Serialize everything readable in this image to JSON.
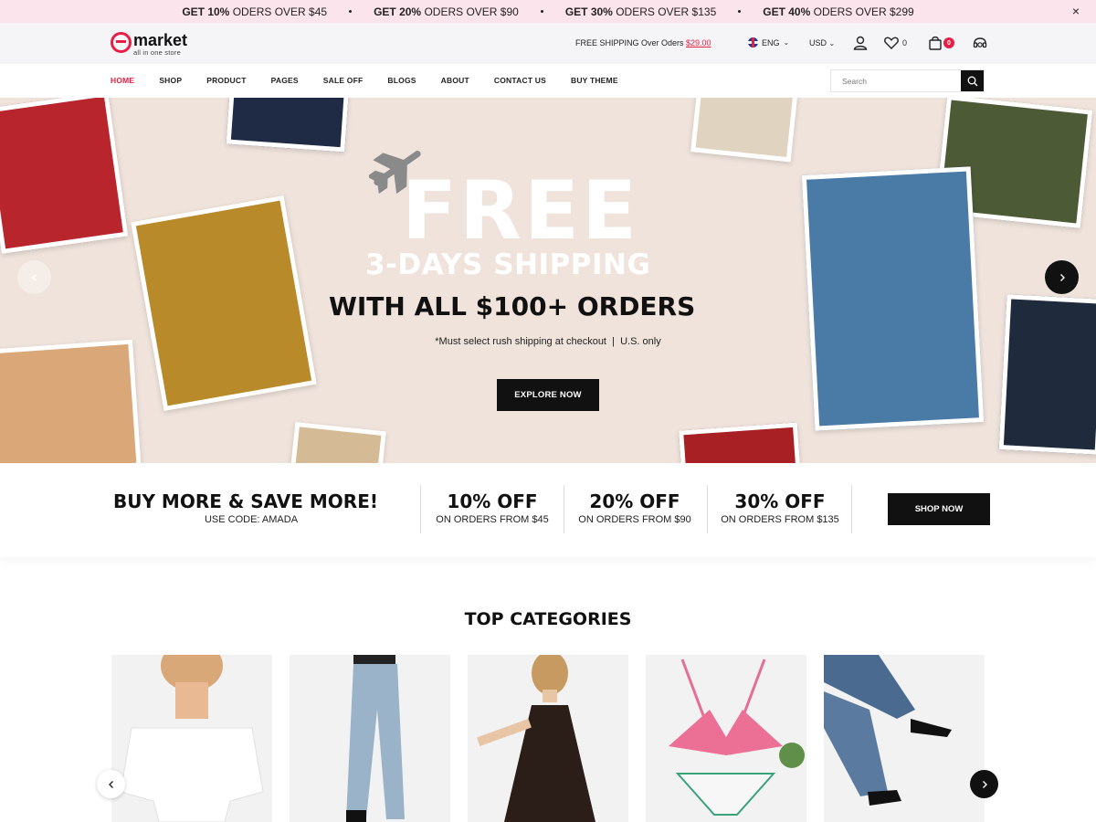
{
  "promo": {
    "items": [
      {
        "bold": "GET 10%",
        "rest": " ODERS OVER $45"
      },
      {
        "bold": "GET 20%",
        "rest": " ODERS OVER $90"
      },
      {
        "bold": "GET 30%",
        "rest": " ODERS OVER $135"
      },
      {
        "bold": "GET 40%",
        "rest": " ODERS OVER $299"
      }
    ],
    "close": "×"
  },
  "header": {
    "logo_name": "market",
    "logo_tag": "all in one store",
    "free_shipping_label": "FREE SHIPPING Over Oders ",
    "free_shipping_amount": "$29.00",
    "language": "ENG",
    "currency": "USD",
    "wishlist_count": "0",
    "cart_count": "0",
    "accent": "#e91e46"
  },
  "nav": {
    "items": [
      "HOME",
      "SHOP",
      "PRODUCT",
      "PAGES",
      "SALE OFF",
      "BLOGS",
      "ABOUT",
      "CONTACT US",
      "BUY THEME"
    ],
    "active": "HOME",
    "search_placeholder": "Search"
  },
  "hero": {
    "headline": "FREE",
    "subheadline": "3-DAYS SHIPPING",
    "offer": "WITH ALL $100+ ORDERS",
    "note": "*Must select rush shipping at checkout  |  U.S. only",
    "cta": "EXPLORE NOW"
  },
  "save": {
    "title": "BUY MORE & SAVE MORE!",
    "code": "USE CODE: AMADA",
    "tiers": [
      {
        "title": "10% OFF",
        "sub": "ON ORDERS FROM $45"
      },
      {
        "title": "20% OFF",
        "sub": "ON ORDERS FROM $90"
      },
      {
        "title": "30% OFF",
        "sub": "ON ORDERS FROM $135"
      }
    ],
    "cta": "SHOP NOW"
  },
  "categories": {
    "title": "TOP CATEGORIES"
  }
}
